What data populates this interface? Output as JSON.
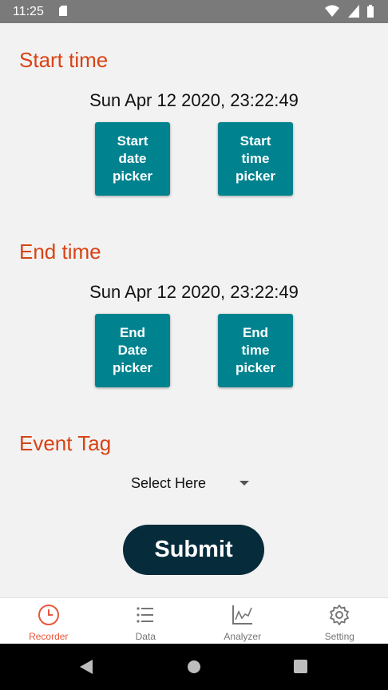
{
  "status_bar": {
    "time": "11:25"
  },
  "start": {
    "title": "Start time",
    "datetime": "Sun Apr 12 2020, 23:22:49",
    "date_button": "Start\ndate\npicker",
    "time_button": "Start\ntime\npicker"
  },
  "end": {
    "title": "End time",
    "datetime": "Sun Apr 12 2020, 23:22:49",
    "date_button": "End\nDate\npicker",
    "time_button": "End\ntime\npicker"
  },
  "event_tag": {
    "title": "Event Tag",
    "selected": "Select Here"
  },
  "submit_label": "Submit",
  "bottom_nav": {
    "items": [
      {
        "label": "Recorder",
        "icon": "clock-icon",
        "active": true
      },
      {
        "label": "Data",
        "icon": "list-icon",
        "active": false
      },
      {
        "label": "Analyzer",
        "icon": "chart-icon",
        "active": false
      },
      {
        "label": "Setting",
        "icon": "gear-icon",
        "active": false
      }
    ]
  },
  "colors": {
    "accent": "#d84315",
    "picker_button": "#00838f",
    "submit_button": "#062c3c",
    "nav_active": "#e8573a"
  }
}
